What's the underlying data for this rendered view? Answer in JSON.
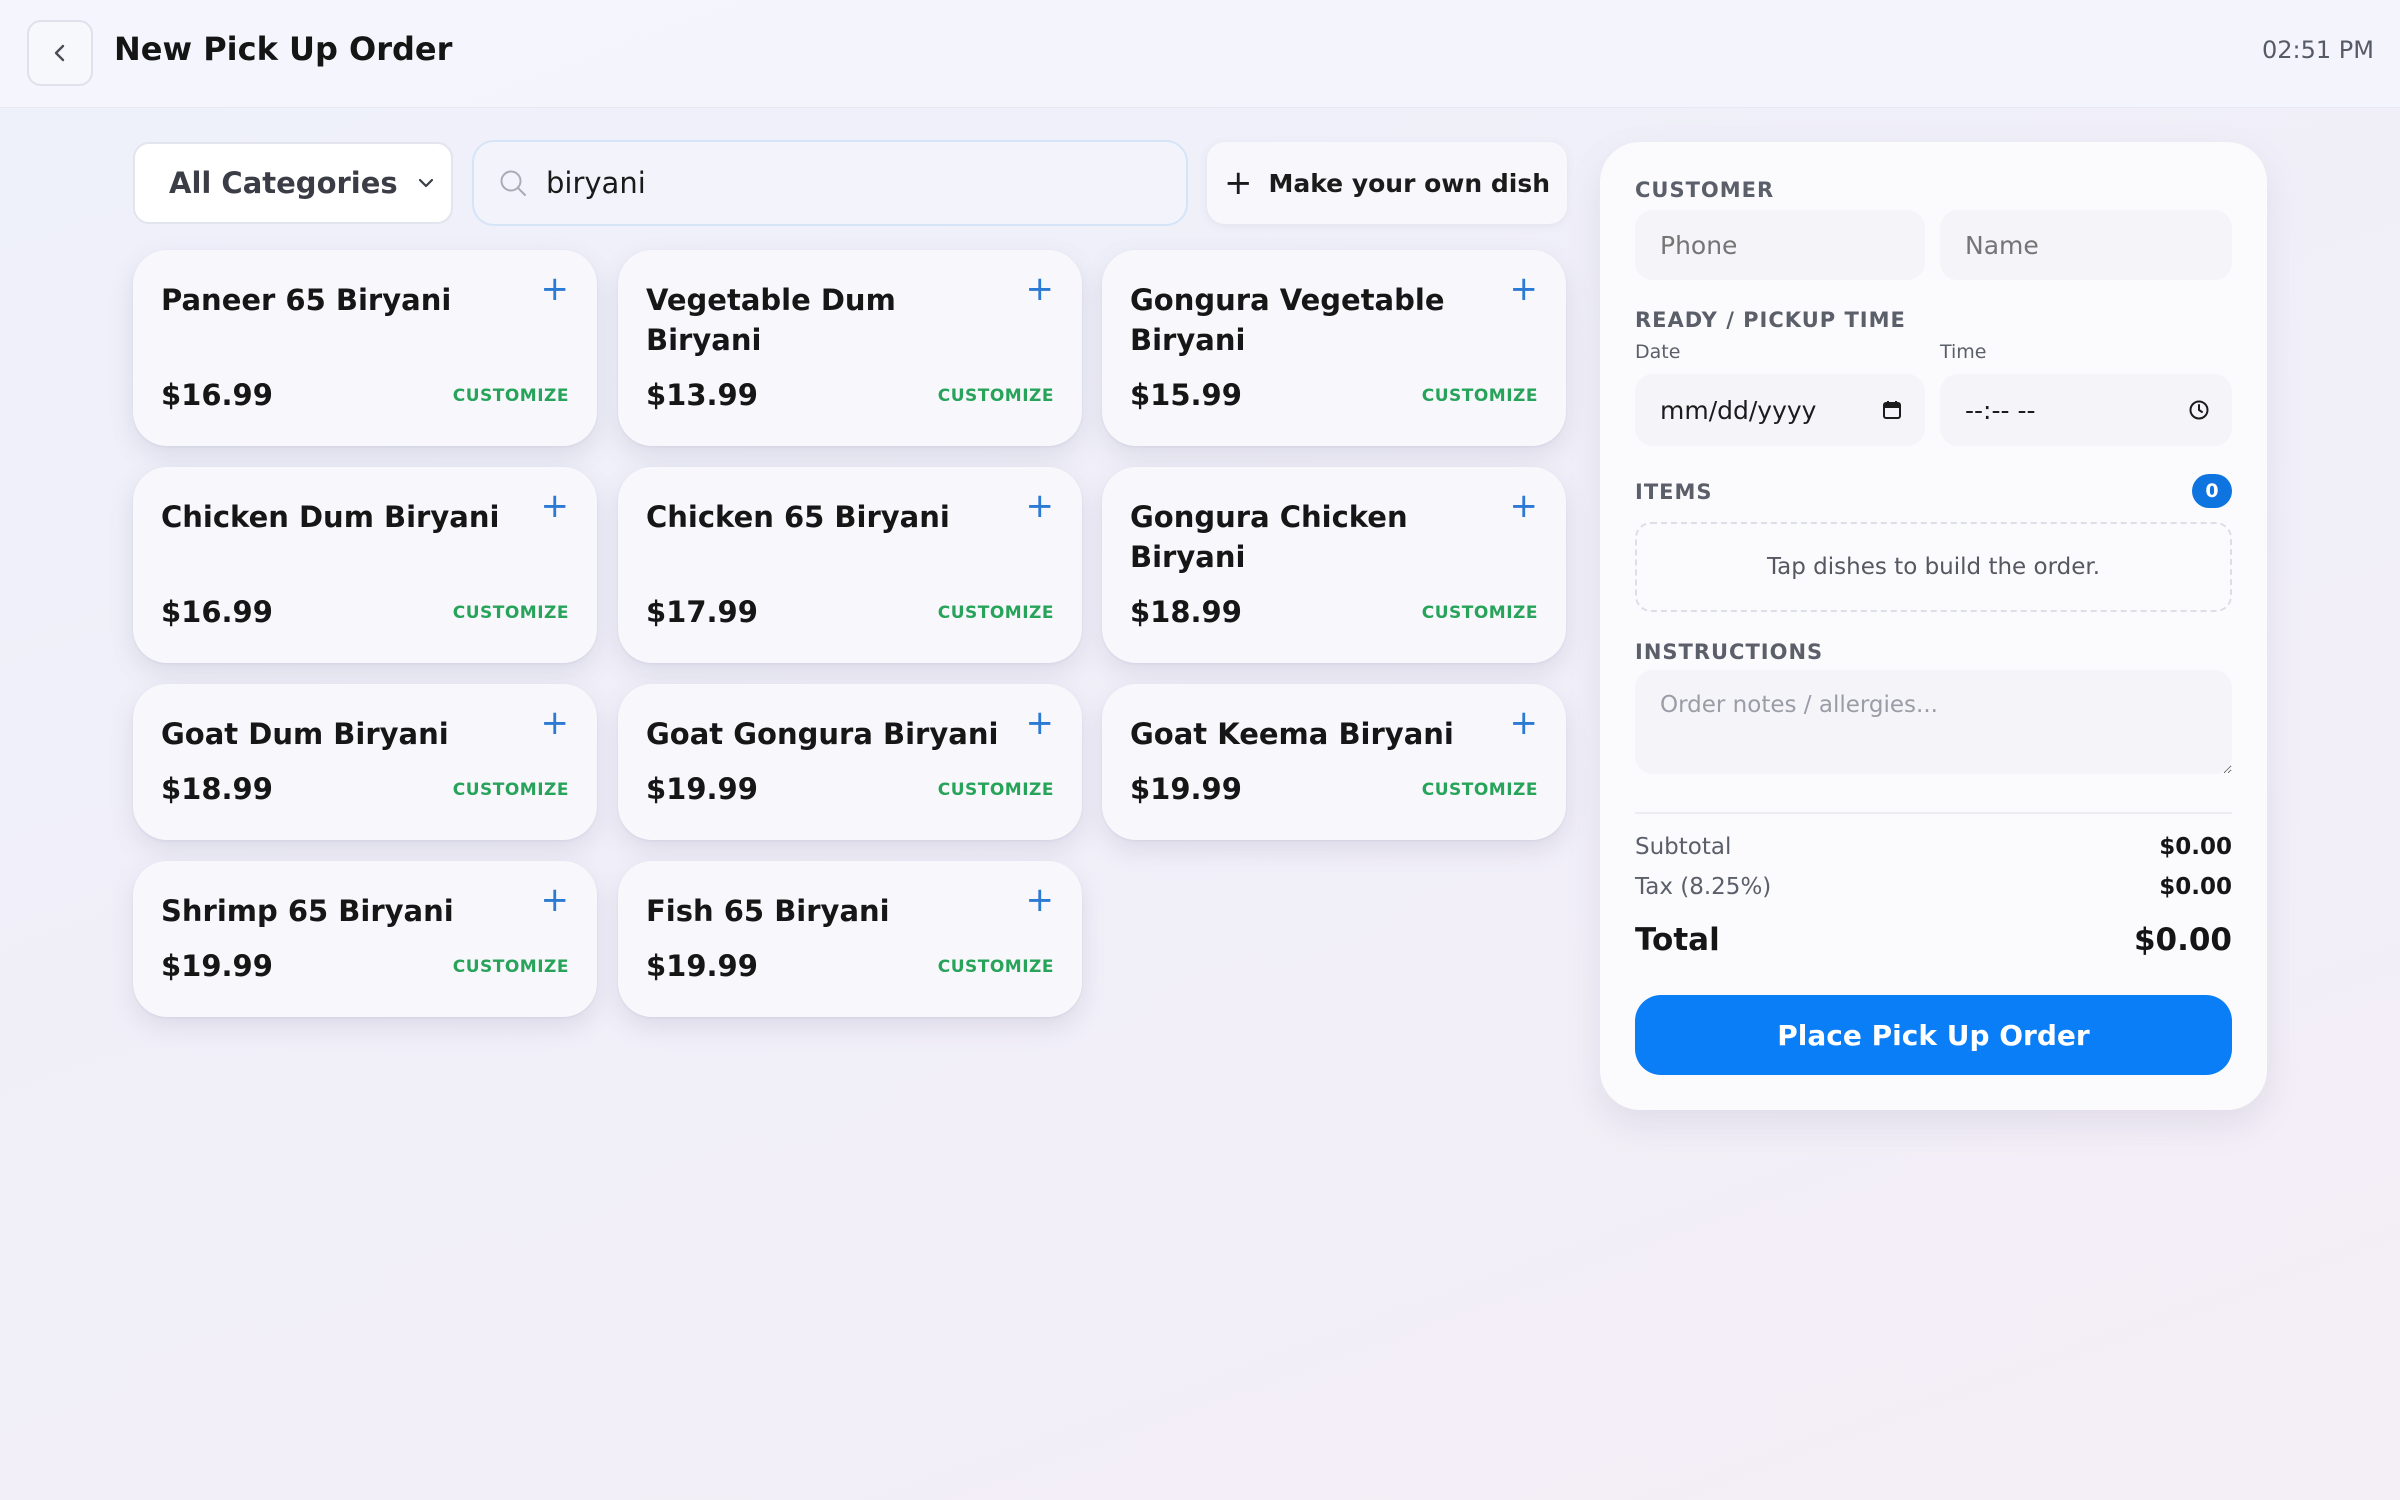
{
  "header": {
    "title": "New Pick Up Order",
    "time": "02:51 PM"
  },
  "filters": {
    "category": "All Categories",
    "search_value": "biryani",
    "own_dish_label": "Make your own dish"
  },
  "dishes": [
    {
      "name": "Paneer 65 Biryani",
      "price": "$16.99",
      "customize": "CUSTOMIZE"
    },
    {
      "name": "Vegetable Dum Biryani",
      "price": "$13.99",
      "customize": "CUSTOMIZE"
    },
    {
      "name": "Gongura Vegetable Biryani",
      "price": "$15.99",
      "customize": "CUSTOMIZE"
    },
    {
      "name": "Chicken Dum Biryani",
      "price": "$16.99",
      "customize": "CUSTOMIZE"
    },
    {
      "name": "Chicken 65 Biryani",
      "price": "$17.99",
      "customize": "CUSTOMIZE"
    },
    {
      "name": "Gongura Chicken Biryani",
      "price": "$18.99",
      "customize": "CUSTOMIZE"
    },
    {
      "name": "Goat Dum Biryani",
      "price": "$18.99",
      "customize": "CUSTOMIZE"
    },
    {
      "name": "Goat Gongura Biryani",
      "price": "$19.99",
      "customize": "CUSTOMIZE"
    },
    {
      "name": "Goat Keema Biryani",
      "price": "$19.99",
      "customize": "CUSTOMIZE"
    },
    {
      "name": "Shrimp 65 Biryani",
      "price": "$19.99",
      "customize": "CUSTOMIZE"
    },
    {
      "name": "Fish 65 Biryani",
      "price": "$19.99",
      "customize": "CUSTOMIZE"
    }
  ],
  "panel": {
    "customer_label": "CUSTOMER",
    "phone_placeholder": "Phone",
    "name_placeholder": "Name",
    "pickup_label": "READY / PICKUP TIME",
    "date_label": "Date",
    "time_label": "Time",
    "date_value": "mm/dd/yyyy",
    "time_value": "--:-- --",
    "items_label": "ITEMS",
    "items_count": "0",
    "items_empty": "Tap dishes to build the order.",
    "instructions_label": "INSTRUCTIONS",
    "notes_placeholder": "Order notes / allergies...",
    "subtotal_label": "Subtotal",
    "subtotal_value": "$0.00",
    "tax_label": "Tax (8.25%)",
    "tax_value": "$0.00",
    "total_label": "Total",
    "total_value": "$0.00",
    "place_order_label": "Place Pick Up Order"
  },
  "colors": {
    "accent": "#0a7ef6",
    "customize_green": "#27a35a",
    "add_blue": "#2b7ad3"
  }
}
